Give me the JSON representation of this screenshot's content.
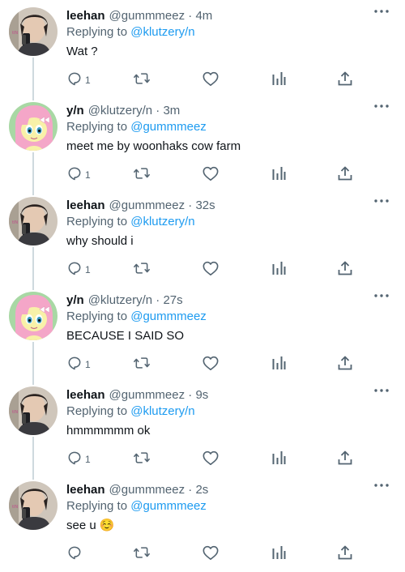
{
  "replying_label": "Replying to",
  "tweets": [
    {
      "name": "leehan",
      "handle": "@gummmeez",
      "separator": "·",
      "time": "4m",
      "reply_to": "@klutzery/n",
      "text": "Wat ?",
      "reply_count": "1",
      "avatar": "man-selfie-avatar"
    },
    {
      "name": "y/n",
      "handle": "@klutzery/n",
      "separator": "·",
      "time": "3m",
      "reply_to": "@gummmeez",
      "text": "meet me by woonhaks cow farm",
      "reply_count": "1",
      "avatar": "pink-pony-avatar"
    },
    {
      "name": "leehan",
      "handle": "@gummmeez",
      "separator": "·",
      "time": "32s",
      "reply_to": "@klutzery/n",
      "text": "why should i",
      "reply_count": "1",
      "avatar": "man-selfie-avatar"
    },
    {
      "name": "y/n",
      "handle": "@klutzery/n",
      "separator": "·",
      "time": "27s",
      "reply_to": "@gummmeez",
      "text": "BECAUSE I SAID SO",
      "reply_count": "1",
      "avatar": "pink-pony-avatar"
    },
    {
      "name": "leehan",
      "handle": "@gummmeez",
      "separator": "·",
      "time": "9s",
      "reply_to": "@klutzery/n",
      "text": "hmmmmmm ok",
      "reply_count": "1",
      "avatar": "man-selfie-avatar"
    },
    {
      "name": "leehan",
      "handle": "@gummmeez",
      "separator": "·",
      "time": "2s",
      "reply_to": "@gummmeez",
      "text": "see u ☺️",
      "reply_count": "",
      "avatar": "man-selfie-avatar"
    }
  ],
  "icons": {
    "more": "more-dots-icon",
    "reply": "reply-bubble-icon",
    "retweet": "retweet-icon",
    "like": "heart-icon",
    "stats": "stats-bars-icon",
    "share": "share-upload-icon"
  },
  "colors": {
    "text": "#0f1419",
    "secondary": "#536471",
    "mention": "#1d9bf0",
    "thread_line": "#cfd9de"
  }
}
